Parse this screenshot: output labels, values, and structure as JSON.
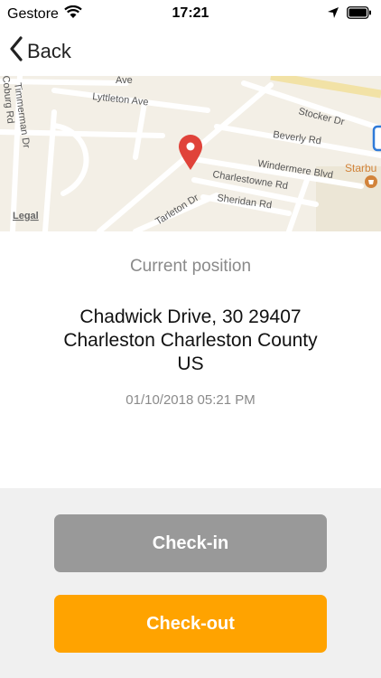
{
  "status_bar": {
    "carrier": "Gestore",
    "time": "17:21",
    "icons": [
      "wifi-icon",
      "location-arrow-icon",
      "battery-icon"
    ]
  },
  "nav": {
    "back_label": "Back"
  },
  "map": {
    "legal_label": "Legal",
    "streets": {
      "lyttleton": "Lyttleton Ave",
      "stocker": "Stocker Dr",
      "beverly": "Beverly Rd",
      "windermere": "Windermere Blvd",
      "charlestowne": "Charlestowne Rd",
      "sheridan": "Sheridan Rd",
      "tarleton": "Tarleton Dr",
      "timmerman": "Timmerman Dr",
      "coburg": "Coburg Rd",
      "top_ave": "Ave"
    },
    "poi": {
      "starbucks": "Starbu"
    },
    "colors": {
      "pin": "#e0433a",
      "land": "#f3efe6",
      "road": "#ffffff",
      "poi": "#d2833a"
    }
  },
  "position": {
    "title": "Current position",
    "address_line1": "Chadwick Drive, 30 29407",
    "address_line2": "Charleston Charleston County",
    "address_line3": "US",
    "timestamp": "01/10/2018 05:21 PM"
  },
  "actions": {
    "checkin_label": "Check-in",
    "checkout_label": "Check-out",
    "checkin_color": "#999999",
    "checkout_color": "#ffa300"
  }
}
